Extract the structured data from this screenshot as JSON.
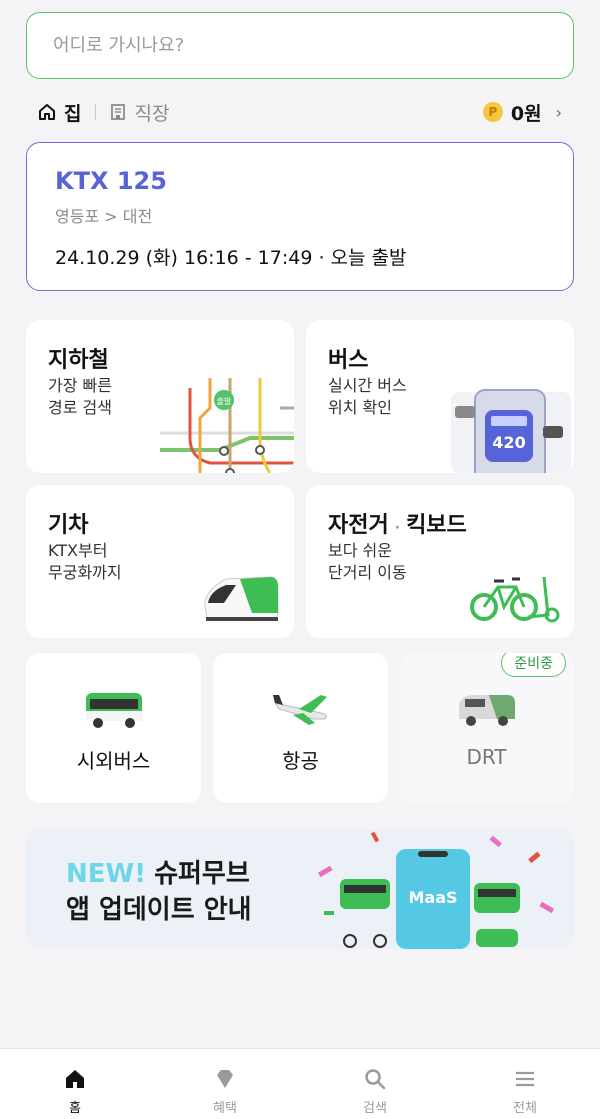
{
  "search": {
    "placeholder": "어디로 가시나요?"
  },
  "places": {
    "home": "집",
    "work": "직장"
  },
  "point": {
    "coin": "P",
    "amount": "0원"
  },
  "ticket": {
    "train": "KTX 125",
    "route": "영등포 > 대전",
    "time": "24.10.29 (화) 16:16 - 17:49 · 오늘 출발"
  },
  "cards": {
    "subway": {
      "title": "지하철",
      "desc1": "가장 빠른",
      "desc2": "경로 검색",
      "pin_label": "출발"
    },
    "bus": {
      "title": "버스",
      "desc1": "실시간 버스",
      "desc2": "위치 확인",
      "bus_number": "420"
    },
    "train": {
      "title": "기차",
      "desc1": "KTX부터",
      "desc2": "무궁화까지"
    },
    "bike": {
      "title": "자전거",
      "title2": "킥보드",
      "desc1": "보다 쉬운",
      "desc2": "단거리 이동"
    }
  },
  "tiles": {
    "intercity": {
      "label": "시외버스"
    },
    "air": {
      "label": "항공"
    },
    "drt": {
      "label": "DRT",
      "badge": "준비중"
    }
  },
  "banner": {
    "new": "NEW!",
    "line1": "슈퍼무브",
    "line2": "앱 업데이트 안내",
    "phone_label": "MaaS"
  },
  "nav": {
    "home": "홈",
    "benefit": "혜택",
    "search": "검색",
    "all": "전체"
  },
  "colors": {
    "brand_green": "#57c66a",
    "ticket_blue": "#5a63d6",
    "background": "#f4f4f6"
  }
}
